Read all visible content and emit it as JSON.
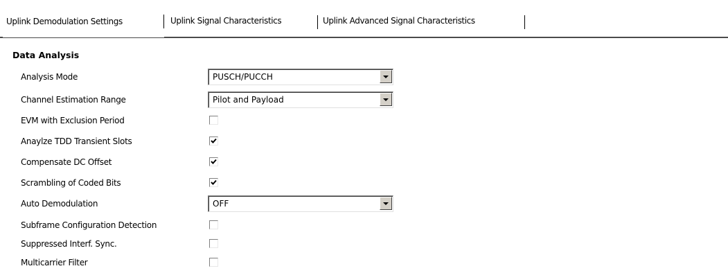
{
  "tabs": [
    {
      "label": "Uplink Demodulation Settings",
      "active": true
    },
    {
      "label": "Uplink Signal Characteristics",
      "active": false
    },
    {
      "label": "Uplink Advanced Signal Characteristics",
      "active": false
    }
  ],
  "section": {
    "title": "Data Analysis"
  },
  "fields": {
    "analysis_mode": {
      "label": "Analysis Mode",
      "value": "PUSCH/PUCCH"
    },
    "channel_estimation_range": {
      "label": "Channel Estimation Range",
      "value": "Pilot and Payload"
    },
    "evm_exclusion": {
      "label": "EVM with Exclusion Period",
      "checked": false
    },
    "tdd_transient": {
      "label": "Anaylze TDD Transient Slots",
      "checked": true
    },
    "dc_offset": {
      "label": "Compensate DC Offset",
      "checked": true
    },
    "scrambling": {
      "label": "Scrambling of Coded Bits",
      "checked": true
    },
    "auto_demod": {
      "label": "Auto Demodulation",
      "value": "OFF"
    },
    "subframe_detection": {
      "label": "Subframe Configuration Detection",
      "checked": false
    },
    "suppressed_sync": {
      "label": "Suppressed Interf. Sync.",
      "checked": false
    },
    "multicarrier_filter": {
      "label": "Multicarrier Filter",
      "checked": false
    }
  }
}
